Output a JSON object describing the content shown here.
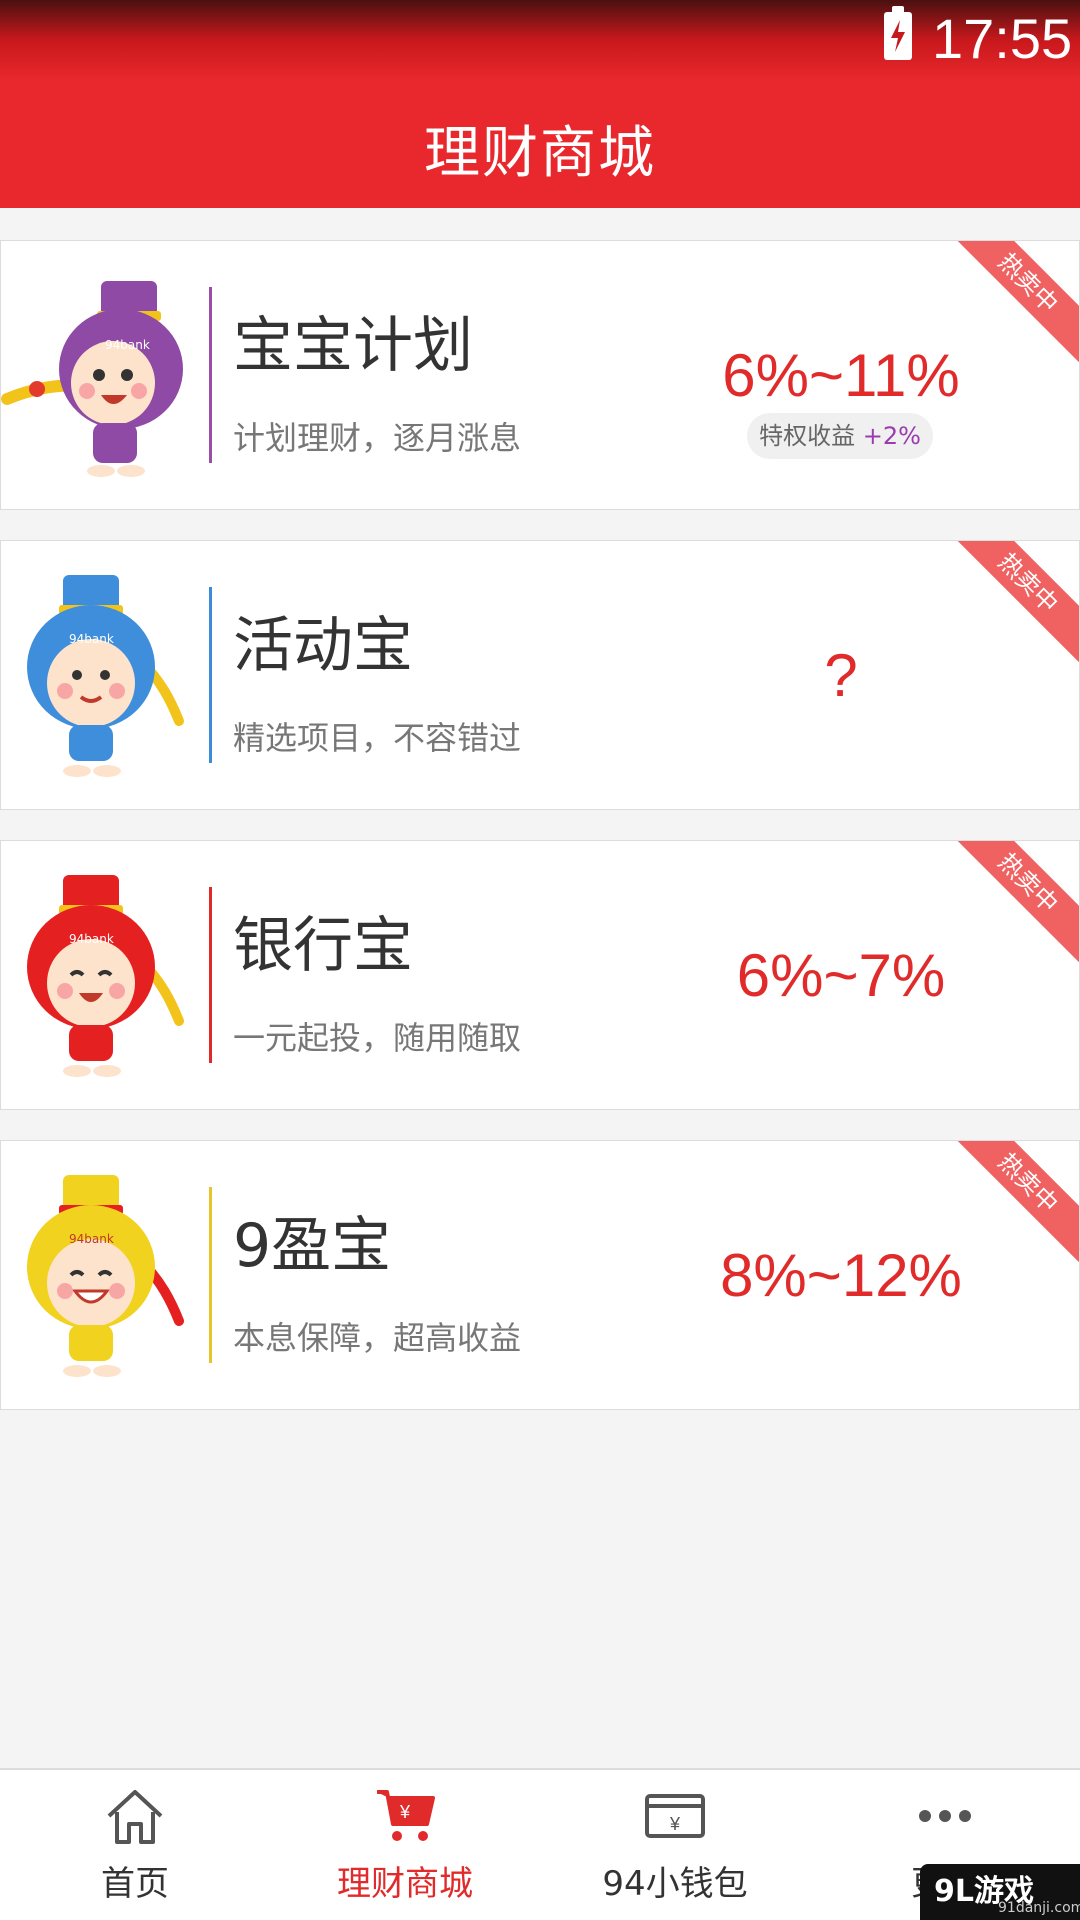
{
  "status_bar": {
    "time": "17:55"
  },
  "header": {
    "title": "理财商城"
  },
  "products": [
    {
      "name": "宝宝计划",
      "desc": "计划理财，逐月涨息",
      "rate": "6%~11%",
      "bonus_label": "特权收益",
      "bonus_value": "+2%",
      "badge": "热卖中",
      "accent": "#9b4ea6",
      "mascot_color": "#8e4aa4"
    },
    {
      "name": "活动宝",
      "desc": "精选项目，不容错过",
      "rate": "?",
      "badge": "热卖中",
      "accent": "#3b8bd6",
      "mascot_color": "#3e8edc"
    },
    {
      "name": "银行宝",
      "desc": "一元起投，随用随取",
      "rate": "6%~7%",
      "badge": "热卖中",
      "accent": "#e02a2a",
      "mascot_color": "#e52020"
    },
    {
      "name": "9盈宝",
      "desc": "本息保障，超高收益",
      "rate": "8%~12%",
      "badge": "热卖中",
      "accent": "#e7c52a",
      "mascot_color": "#f1d21f"
    }
  ],
  "mascot_text": "94bank",
  "bottom_nav": [
    {
      "label": "首页",
      "icon": "home-icon"
    },
    {
      "label": "理财商城",
      "icon": "cart-icon",
      "active": true
    },
    {
      "label": "94小钱包",
      "icon": "wallet-icon"
    },
    {
      "label": "更多",
      "icon": "more-icon"
    }
  ],
  "watermark": {
    "main": "9L游戏",
    "sub": "91danji.com"
  },
  "colors": {
    "brand": "#e8282c",
    "rate": "#e12b2b"
  }
}
